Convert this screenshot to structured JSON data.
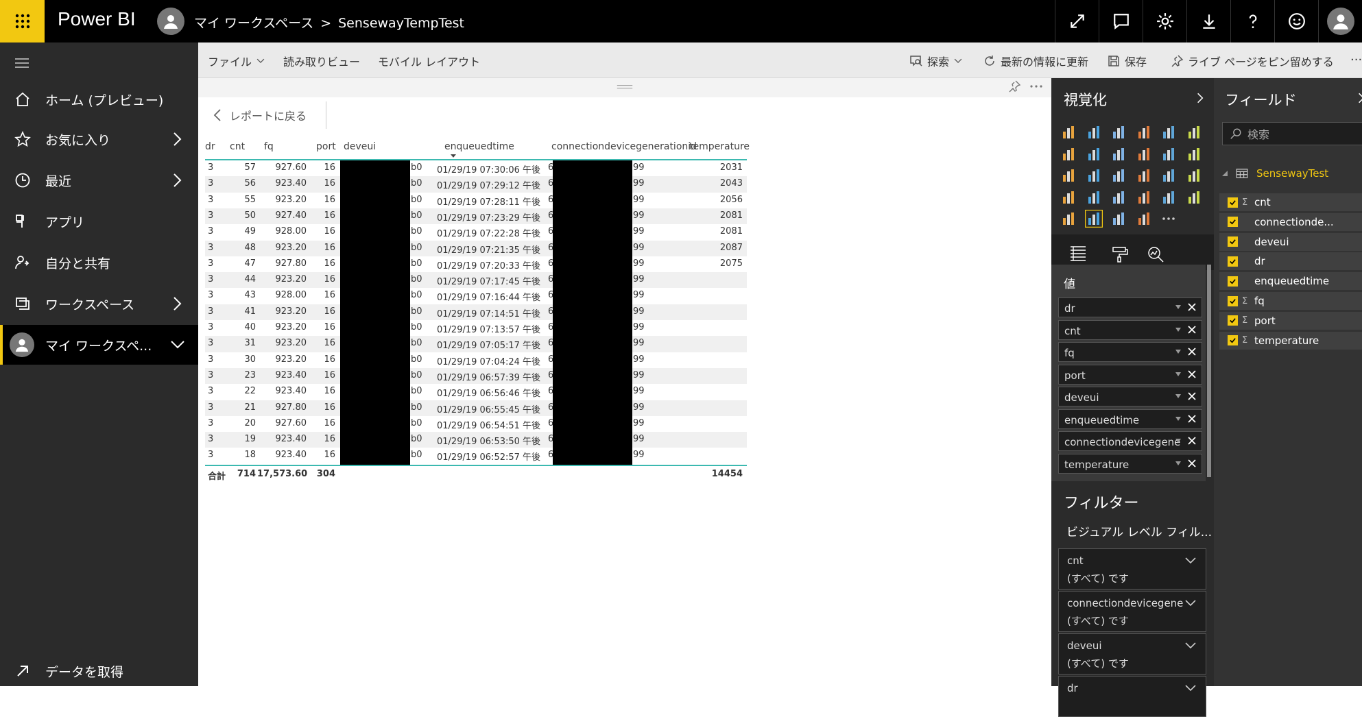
{
  "topbar": {
    "brand": "Power BI",
    "breadcrumb_workspace": "マイ ワークスペース",
    "breadcrumb_sep": ">",
    "breadcrumb_report": "SensewayTempTest",
    "icons": [
      "expand-icon",
      "comment-icon",
      "gear-icon",
      "download-icon",
      "help-icon",
      "smiley-icon",
      "user-avatar"
    ]
  },
  "leftnav": {
    "items": [
      {
        "label": "ホーム (プレビュー)",
        "icon": "home-icon"
      },
      {
        "label": "お気に入り",
        "icon": "star-icon"
      },
      {
        "label": "最近",
        "icon": "clock-icon"
      },
      {
        "label": "アプリ",
        "icon": "apps-icon"
      },
      {
        "label": "自分と共有",
        "icon": "shared-icon"
      },
      {
        "label": "ワークスペース",
        "icon": "workspace-icon"
      },
      {
        "label": "マイ ワークスペ...",
        "icon": "avatar"
      }
    ],
    "get_data": "データを取得"
  },
  "toolbar": {
    "file": "ファイル",
    "reading_view": "読み取りビュー",
    "mobile_layout": "モバイル レイアウト",
    "explore": "探索",
    "refresh": "最新の情報に更新",
    "save": "保存",
    "pin_live": "ライブ ページをピン留めする",
    "more": "..."
  },
  "canvas": {
    "back_label": "レポートに戻る"
  },
  "table": {
    "headers": [
      "dr",
      "cnt",
      "fq",
      "port",
      "deveui",
      "enqueuedtime",
      "connectiondevicegenerationid",
      "temperature"
    ],
    "rows": [
      {
        "dr": "3",
        "cnt": "57",
        "fq": "927.60",
        "port": "16",
        "deveui_suffix": "b0",
        "time": "01/29/19 07:30:06 午後",
        "conn_prefix": "6",
        "conn_suffix": "99",
        "temperature": "2031"
      },
      {
        "dr": "3",
        "cnt": "56",
        "fq": "923.40",
        "port": "16",
        "deveui_suffix": "b0",
        "time": "01/29/19 07:29:12 午後",
        "conn_prefix": "6",
        "conn_suffix": "99",
        "temperature": "2043"
      },
      {
        "dr": "3",
        "cnt": "55",
        "fq": "923.20",
        "port": "16",
        "deveui_suffix": "b0",
        "time": "01/29/19 07:28:11 午後",
        "conn_prefix": "6",
        "conn_suffix": "99",
        "temperature": "2056"
      },
      {
        "dr": "3",
        "cnt": "50",
        "fq": "927.40",
        "port": "16",
        "deveui_suffix": "b0",
        "time": "01/29/19 07:23:29 午後",
        "conn_prefix": "6",
        "conn_suffix": "99",
        "temperature": "2081"
      },
      {
        "dr": "3",
        "cnt": "49",
        "fq": "928.00",
        "port": "16",
        "deveui_suffix": "b0",
        "time": "01/29/19 07:22:28 午後",
        "conn_prefix": "6",
        "conn_suffix": "99",
        "temperature": "2081"
      },
      {
        "dr": "3",
        "cnt": "48",
        "fq": "923.20",
        "port": "16",
        "deveui_suffix": "b0",
        "time": "01/29/19 07:21:35 午後",
        "conn_prefix": "6",
        "conn_suffix": "99",
        "temperature": "2087"
      },
      {
        "dr": "3",
        "cnt": "47",
        "fq": "927.80",
        "port": "16",
        "deveui_suffix": "b0",
        "time": "01/29/19 07:20:33 午後",
        "conn_prefix": "6",
        "conn_suffix": "99",
        "temperature": "2075"
      },
      {
        "dr": "3",
        "cnt": "44",
        "fq": "923.20",
        "port": "16",
        "deveui_suffix": "b0",
        "time": "01/29/19 07:17:45 午後",
        "conn_prefix": "6",
        "conn_suffix": "99",
        "temperature": ""
      },
      {
        "dr": "3",
        "cnt": "43",
        "fq": "928.00",
        "port": "16",
        "deveui_suffix": "b0",
        "time": "01/29/19 07:16:44 午後",
        "conn_prefix": "6",
        "conn_suffix": "99",
        "temperature": ""
      },
      {
        "dr": "3",
        "cnt": "41",
        "fq": "923.20",
        "port": "16",
        "deveui_suffix": "b0",
        "time": "01/29/19 07:14:51 午後",
        "conn_prefix": "6",
        "conn_suffix": "99",
        "temperature": ""
      },
      {
        "dr": "3",
        "cnt": "40",
        "fq": "923.20",
        "port": "16",
        "deveui_suffix": "b0",
        "time": "01/29/19 07:13:57 午後",
        "conn_prefix": "6",
        "conn_suffix": "99",
        "temperature": ""
      },
      {
        "dr": "3",
        "cnt": "31",
        "fq": "923.20",
        "port": "16",
        "deveui_suffix": "b0",
        "time": "01/29/19 07:05:17 午後",
        "conn_prefix": "6",
        "conn_suffix": "99",
        "temperature": ""
      },
      {
        "dr": "3",
        "cnt": "30",
        "fq": "923.20",
        "port": "16",
        "deveui_suffix": "b0",
        "time": "01/29/19 07:04:24 午後",
        "conn_prefix": "6",
        "conn_suffix": "99",
        "temperature": ""
      },
      {
        "dr": "3",
        "cnt": "23",
        "fq": "923.40",
        "port": "16",
        "deveui_suffix": "b0",
        "time": "01/29/19 06:57:39 午後",
        "conn_prefix": "6",
        "conn_suffix": "99",
        "temperature": ""
      },
      {
        "dr": "3",
        "cnt": "22",
        "fq": "923.40",
        "port": "16",
        "deveui_suffix": "b0",
        "time": "01/29/19 06:56:46 午後",
        "conn_prefix": "6",
        "conn_suffix": "99",
        "temperature": ""
      },
      {
        "dr": "3",
        "cnt": "21",
        "fq": "927.80",
        "port": "16",
        "deveui_suffix": "b0",
        "time": "01/29/19 06:55:45 午後",
        "conn_prefix": "6",
        "conn_suffix": "99",
        "temperature": ""
      },
      {
        "dr": "3",
        "cnt": "20",
        "fq": "927.60",
        "port": "16",
        "deveui_suffix": "b0",
        "time": "01/29/19 06:54:51 午後",
        "conn_prefix": "6",
        "conn_suffix": "99",
        "temperature": ""
      },
      {
        "dr": "3",
        "cnt": "19",
        "fq": "923.40",
        "port": "16",
        "deveui_suffix": "b0",
        "time": "01/29/19 06:53:50 午後",
        "conn_prefix": "6",
        "conn_suffix": "99",
        "temperature": ""
      },
      {
        "dr": "3",
        "cnt": "18",
        "fq": "923.40",
        "port": "16",
        "deveui_suffix": "b0",
        "time": "01/29/19 06:52:57 午後",
        "conn_prefix": "6",
        "conn_suffix": "99",
        "temperature": ""
      }
    ],
    "totals": {
      "label": "合計",
      "cnt": "714",
      "fq": "17,573.60",
      "port": "304",
      "temperature": "14454"
    }
  },
  "viz": {
    "title": "視覚化",
    "values_title": "値",
    "wells": [
      "dr",
      "cnt",
      "fq",
      "port",
      "deveui",
      "enqueuedtime",
      "connectiondevicegenera",
      "temperature"
    ],
    "filter_title": "フィルター",
    "filter_sub": "ビジュアル レベル フィル...",
    "filters": [
      {
        "name": "cnt",
        "value": "(すべて) です"
      },
      {
        "name": "connectiondevicegene...",
        "value": "(すべて) です"
      },
      {
        "name": "deveui",
        "value": "(すべて) です"
      },
      {
        "name": "dr",
        "value": ""
      }
    ]
  },
  "fields": {
    "title": "フィールド",
    "search_placeholder": "検索",
    "table_name": "SensewayTest",
    "items": [
      {
        "name": "cnt",
        "sigma": "Σ"
      },
      {
        "name": "connectionde...",
        "sigma": ""
      },
      {
        "name": "deveui",
        "sigma": ""
      },
      {
        "name": "dr",
        "sigma": ""
      },
      {
        "name": "enqueuedtime",
        "sigma": ""
      },
      {
        "name": "fq",
        "sigma": "Σ"
      },
      {
        "name": "port",
        "sigma": "Σ"
      },
      {
        "name": "temperature",
        "sigma": "Σ"
      }
    ]
  },
  "colors": {
    "accent": "#f2c811",
    "teal": "#3bb9b0",
    "nav_bg": "#2b2b2b"
  }
}
